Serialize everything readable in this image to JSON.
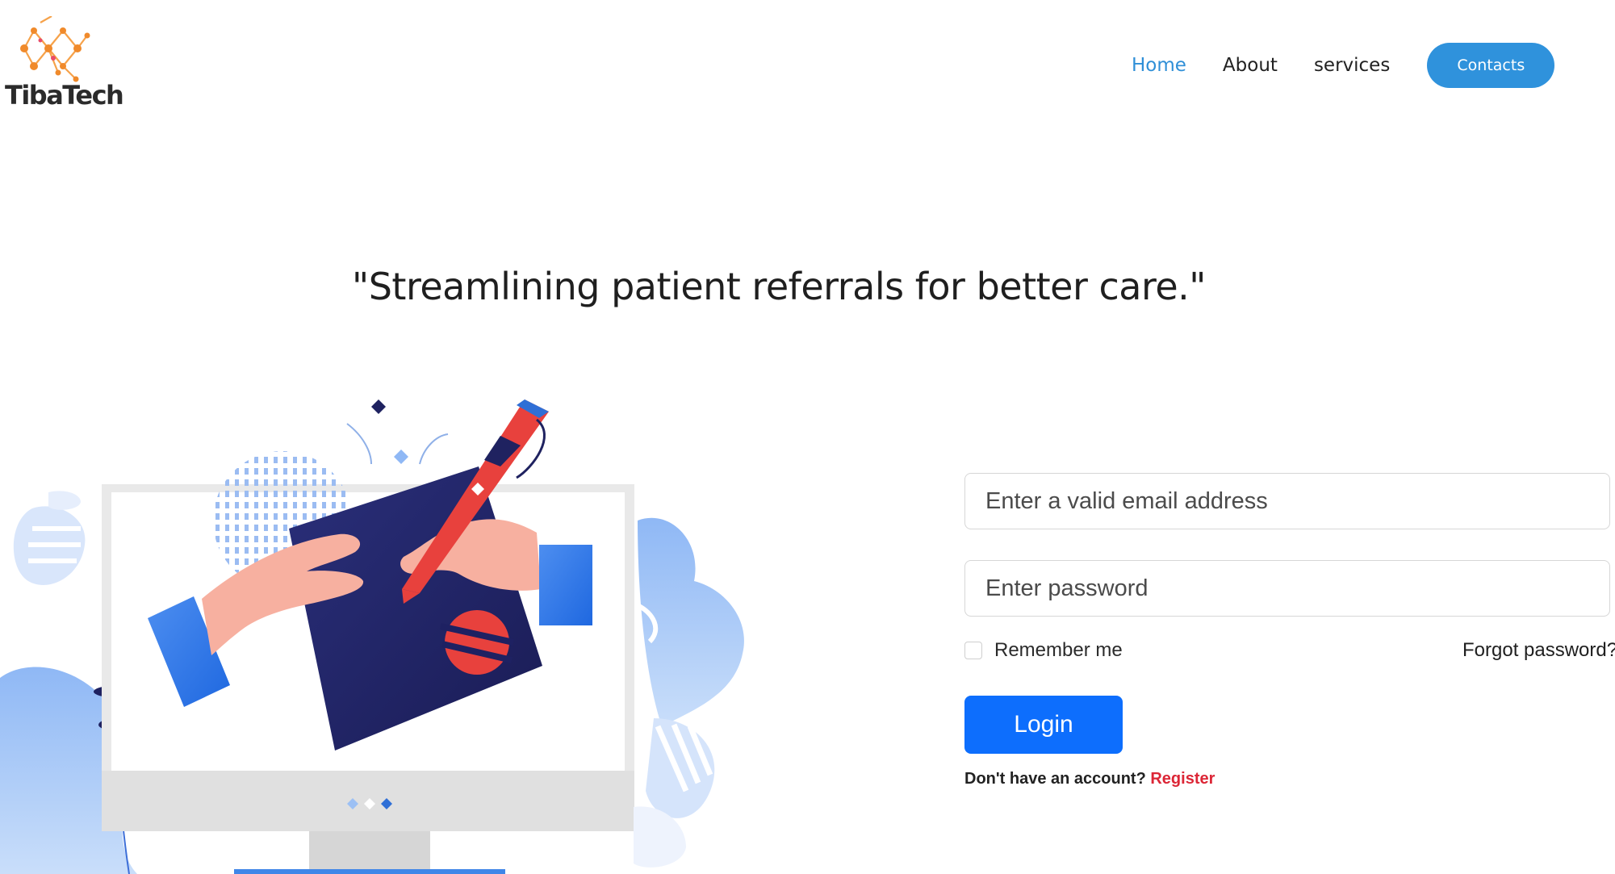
{
  "brand": {
    "name": "TibaTech",
    "icon": "network-molecule-logo"
  },
  "nav": {
    "items": [
      {
        "label": "Home",
        "active": true
      },
      {
        "label": "About",
        "active": false
      },
      {
        "label": "services",
        "active": false
      }
    ],
    "cta_label": "Contacts"
  },
  "hero": {
    "tagline": "\"Streamlining patient referrals for better care.\""
  },
  "login": {
    "email_placeholder": "Enter a valid email address",
    "password_placeholder": "Enter password",
    "remember_label": "Remember me",
    "forgot_label": "Forgot password?",
    "submit_label": "Login",
    "no_account_text": "Don't have an account?",
    "register_label": "Register"
  },
  "colors": {
    "accent": "#2f92dc",
    "primary_button": "#0d6efd",
    "register_link": "#dc2636"
  }
}
